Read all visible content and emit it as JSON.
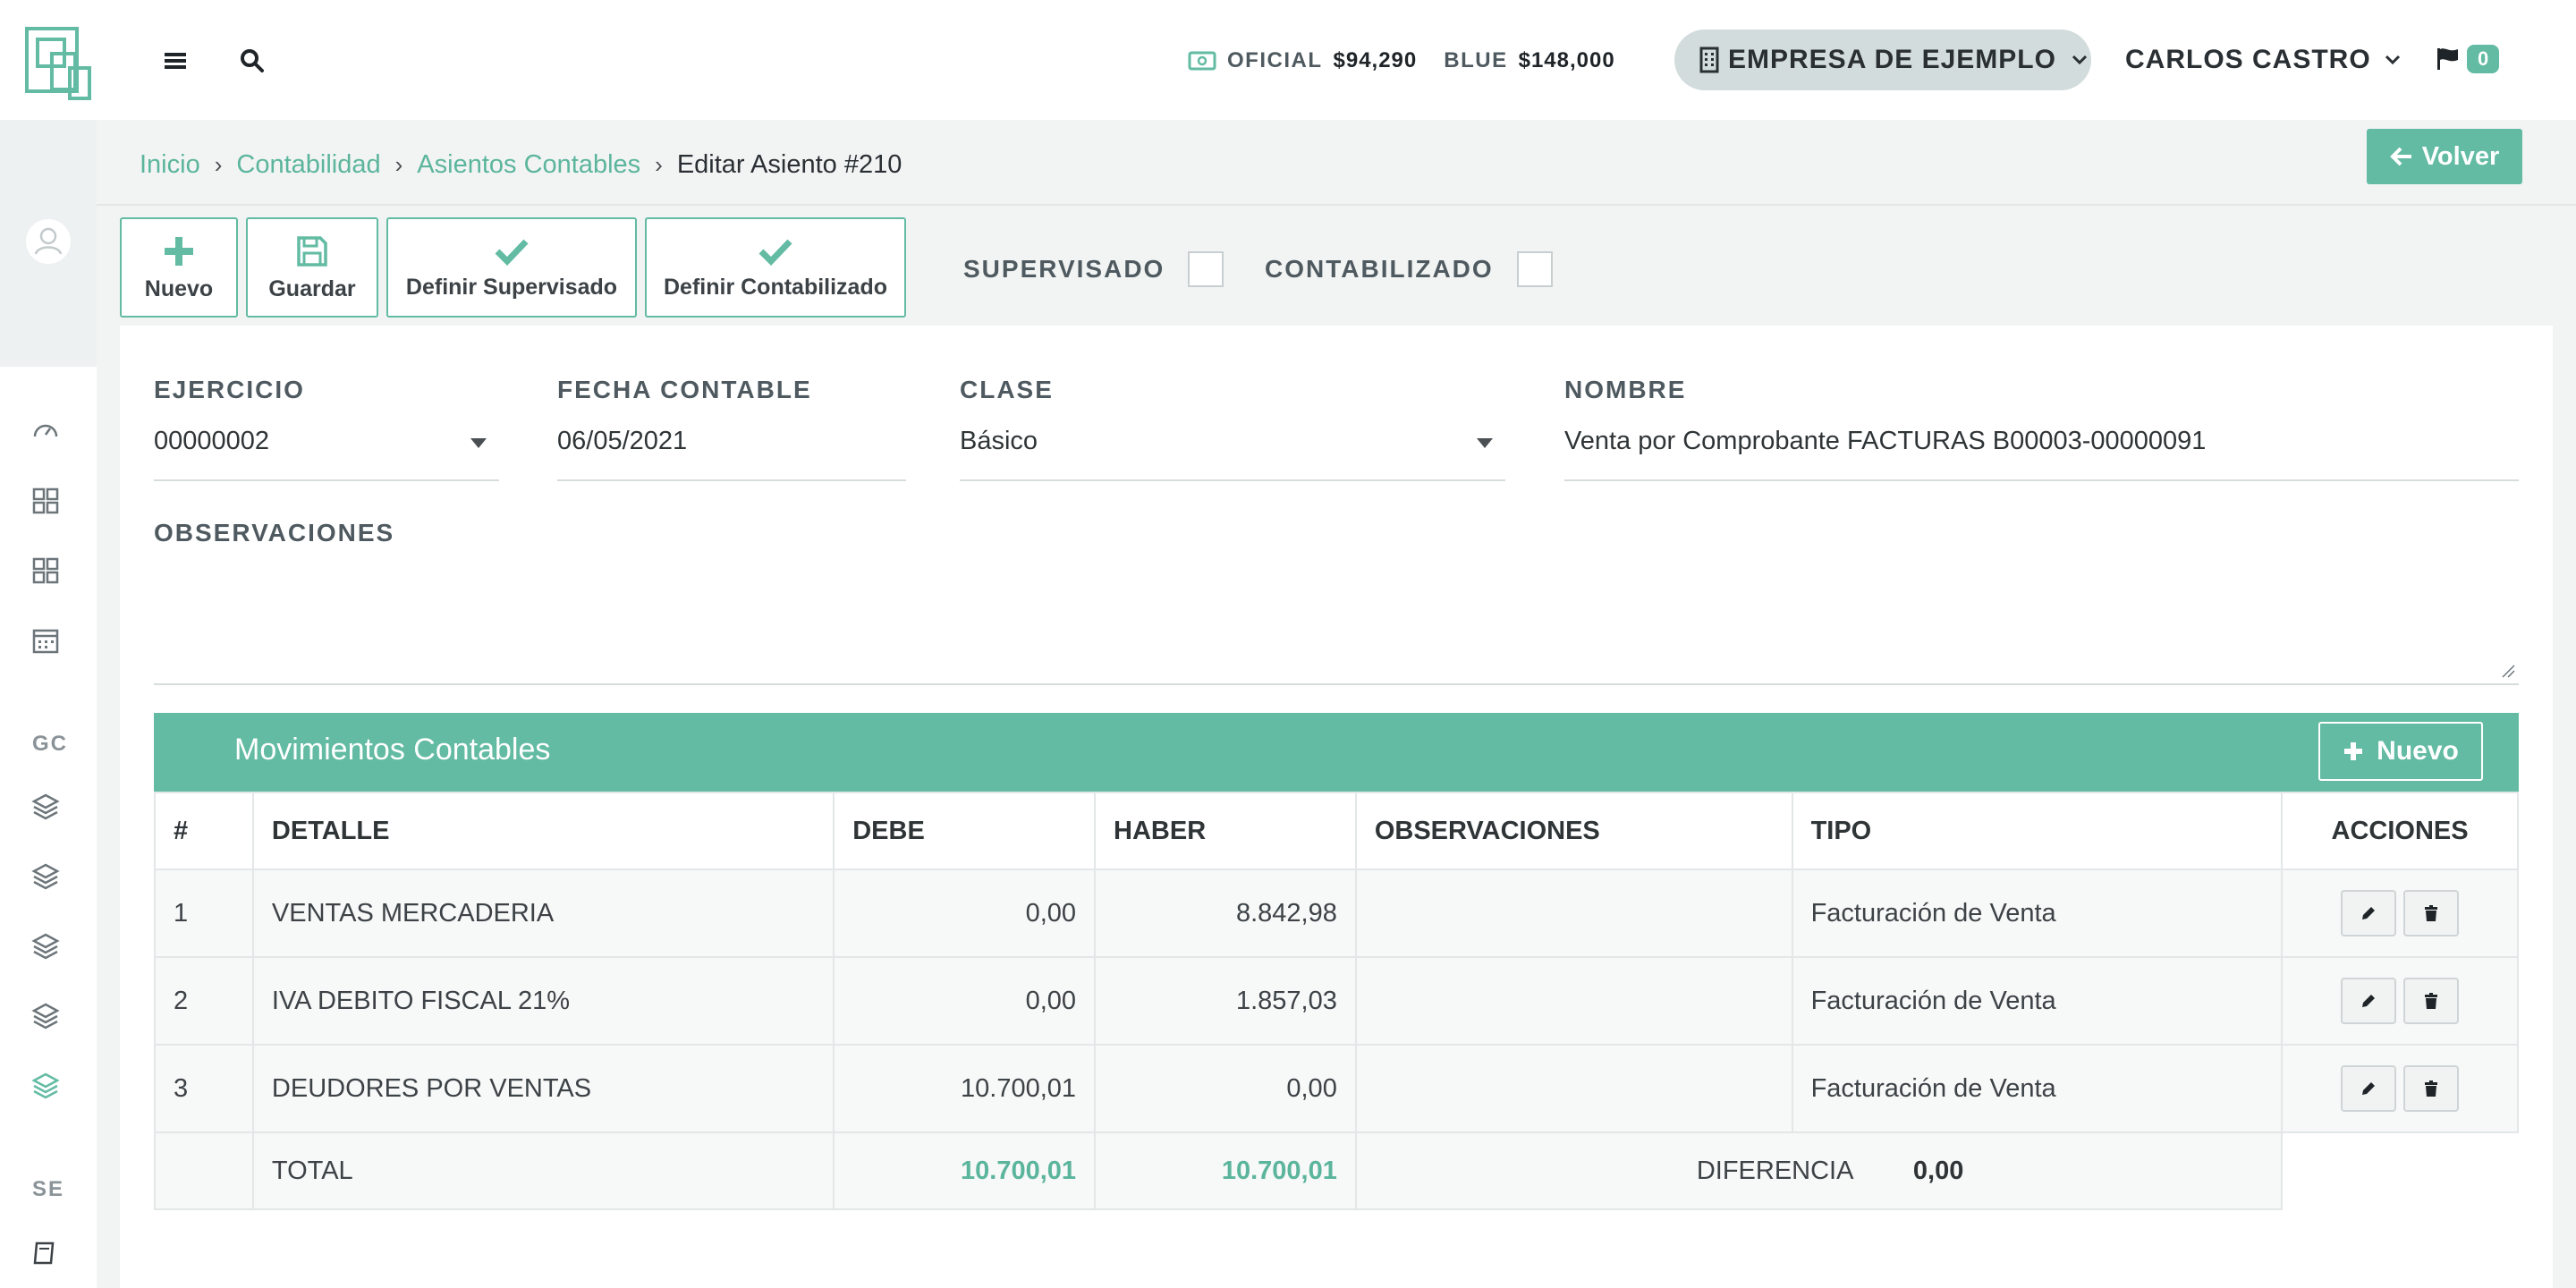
{
  "topbar": {
    "rates": [
      {
        "label": "OFICIAL",
        "value": "$94,290"
      },
      {
        "label": "BLUE",
        "value": "$148,000"
      }
    ],
    "company": "EMPRESA DE EJEMPLO",
    "user": "CARLOS CASTRO",
    "notifications_count": "0"
  },
  "sidebar": {
    "section_gc": "GC",
    "section_se": "SE"
  },
  "breadcrumb": {
    "items": [
      "Inicio",
      "Contabilidad",
      "Asientos Contables"
    ],
    "current": "Editar Asiento #210"
  },
  "back_button": "Volver",
  "toolbar": {
    "nuevo": "Nuevo",
    "guardar": "Guardar",
    "definir_supervisado": "Definir Supervisado",
    "definir_contabilizado": "Definir Contabilizado",
    "supervisado_label": "SUPERVISADO",
    "contabilizado_label": "CONTABILIZADO"
  },
  "form": {
    "ejercicio": {
      "label": "EJERCICIO",
      "value": "00000002"
    },
    "fecha": {
      "label": "FECHA CONTABLE",
      "value": "06/05/2021"
    },
    "clase": {
      "label": "CLASE",
      "value": "Básico"
    },
    "nombre": {
      "label": "NOMBRE",
      "value": "Venta por Comprobante FACTURAS B00003-00000091"
    },
    "observaciones": {
      "label": "OBSERVACIONES",
      "value": ""
    }
  },
  "movimientos": {
    "title": "Movimientos Contables",
    "new_button": "Nuevo",
    "columns": [
      "#",
      "DETALLE",
      "DEBE",
      "HABER",
      "OBSERVACIONES",
      "TIPO",
      "ACCIONES"
    ],
    "rows": [
      {
        "n": "1",
        "detalle": "VENTAS MERCADERIA",
        "debe": "0,00",
        "haber": "8.842,98",
        "obs": "",
        "tipo": "Facturación de Venta"
      },
      {
        "n": "2",
        "detalle": "IVA DEBITO FISCAL 21%",
        "debe": "0,00",
        "haber": "1.857,03",
        "obs": "",
        "tipo": "Facturación de Venta"
      },
      {
        "n": "3",
        "detalle": "DEUDORES POR VENTAS",
        "debe": "10.700,01",
        "haber": "0,00",
        "obs": "",
        "tipo": "Facturación de Venta"
      }
    ],
    "footer": {
      "total_label": "TOTAL",
      "total_debe": "10.700,01",
      "total_haber": "10.700,01",
      "diferencia_label": "DIFERENCIA",
      "diferencia_value": "0,00"
    }
  },
  "colors": {
    "accent": "#62bba2",
    "accent_text": "#5bb59c"
  }
}
